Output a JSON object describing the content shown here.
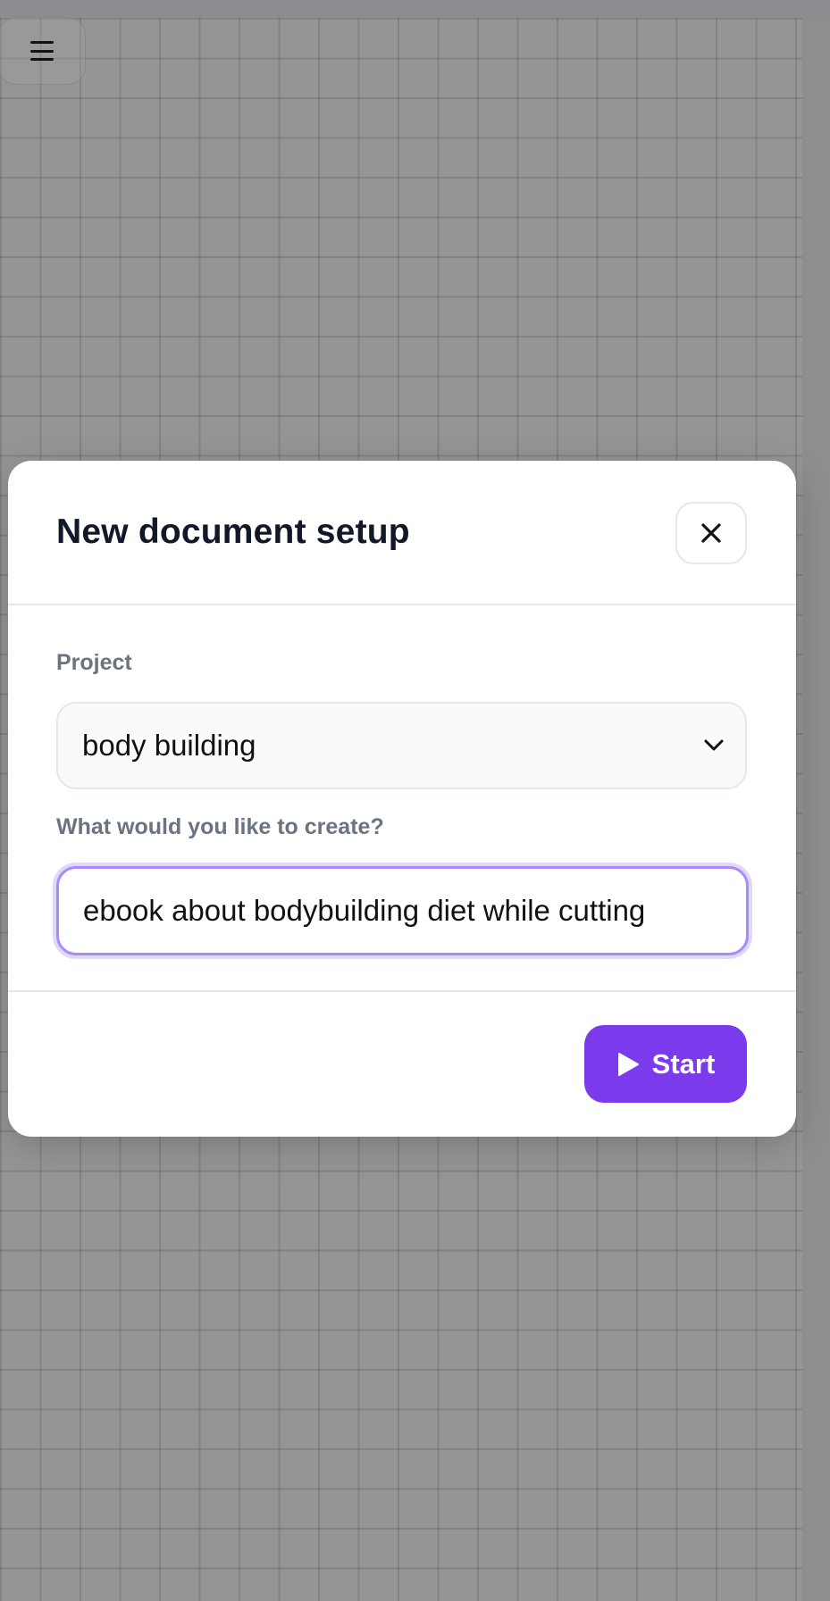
{
  "colors": {
    "accent": "#7c3aed",
    "focus_ring": "#a78bfa",
    "title_text": "#111827",
    "label_text": "#6b7280"
  },
  "menu": {
    "icon": "hamburger-menu-icon"
  },
  "modal": {
    "title": "New document setup",
    "close_icon": "close-icon",
    "project_label": "Project",
    "project_value": "body building",
    "project_dropdown_icon": "chevron-down-icon",
    "create_label": "What would you like to create?",
    "create_value": "ebook about bodybuilding diet while cutting",
    "start_label": "Start",
    "start_icon": "play-icon"
  }
}
